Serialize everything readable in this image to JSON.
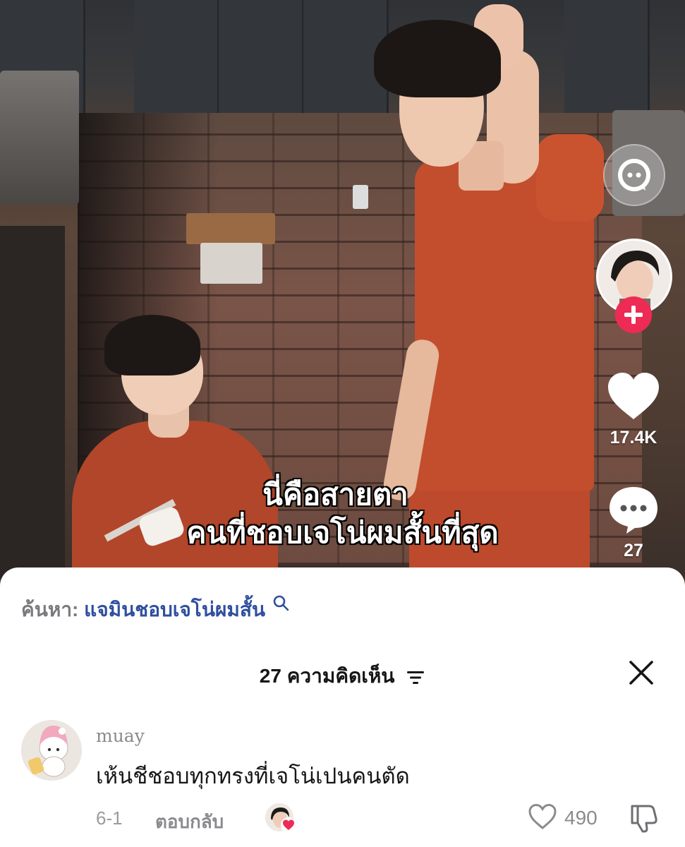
{
  "video": {
    "caption_line1": "นี่คือสายตา",
    "caption_line2": "คนที่ชอบเจโน่ผมสั้นที่สุด"
  },
  "rail": {
    "search_icon": "search-bubble-icon",
    "follow_icon": "plus-icon",
    "like_icon": "heart-icon",
    "likes_count": "17.4K",
    "comment_icon": "comment-bubble-icon",
    "comments_count": "27",
    "follow_color": "#EE2B55"
  },
  "search": {
    "prefix": "ค้นหา:",
    "term": "แจมินชอบเจโน่ผมสั้น",
    "icon": "search-icon",
    "term_color": "#2F4F9F"
  },
  "comments_panel": {
    "title": "27 ความคิดเห็น",
    "filter_icon": "filter-icon",
    "close_icon": "close-icon"
  },
  "comment": {
    "username": "muay",
    "text": "เห้นชีชอบทุกทรงที่เจโน่เปนคนตัด",
    "date": "6-1",
    "reply_label": "ตอบกลับ",
    "like_count": "490",
    "like_icon": "heart-outline-icon",
    "dislike_icon": "thumbs-down-icon"
  }
}
